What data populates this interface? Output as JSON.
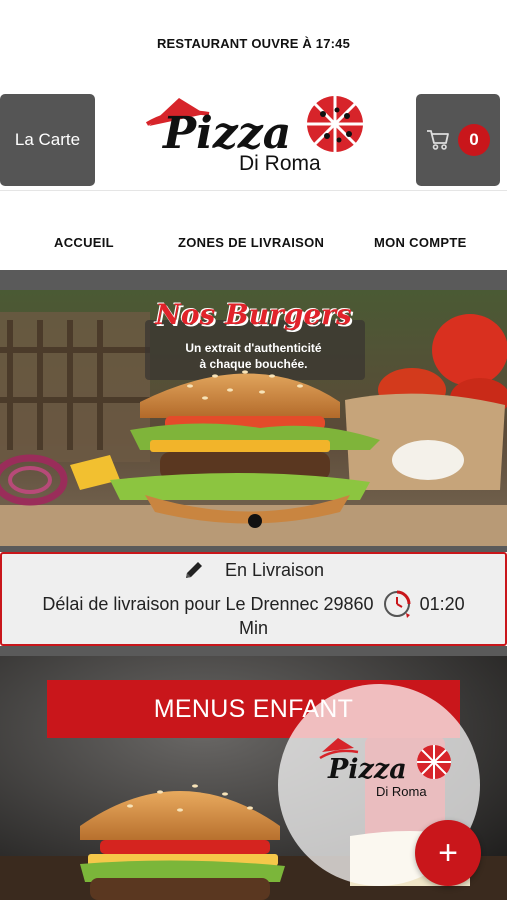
{
  "status_bar": {
    "text": "RESTAURANT OUVRE À 17:45"
  },
  "header": {
    "menu_button": "La Carte",
    "cart_count": "0",
    "logo": {
      "brand": "Pizza",
      "sub": "Di Roma"
    }
  },
  "nav": {
    "items": [
      {
        "label": "ACCUEIL"
      },
      {
        "label": "ZONES DE LIVRAISON"
      },
      {
        "label": "MON COMPTE"
      }
    ]
  },
  "hero": {
    "title": "Nos Burgers",
    "subtitle_line1": "Un extrait d'authenticité",
    "subtitle_line2": "à chaque bouchée."
  },
  "delivery": {
    "mode": "En Livraison",
    "delay_text": "Délai de livraison pour Le Drennec 29860",
    "time": "01:20",
    "unit": "Min"
  },
  "promo": {
    "banner": "MENUS ENFANT",
    "overlay_logo": {
      "brand": "Pizza",
      "sub": "Di Roma"
    }
  },
  "fab": {
    "label": "+"
  },
  "colors": {
    "accent": "#c9161b",
    "button_bg": "#555555",
    "band": "#5a5a5a"
  }
}
